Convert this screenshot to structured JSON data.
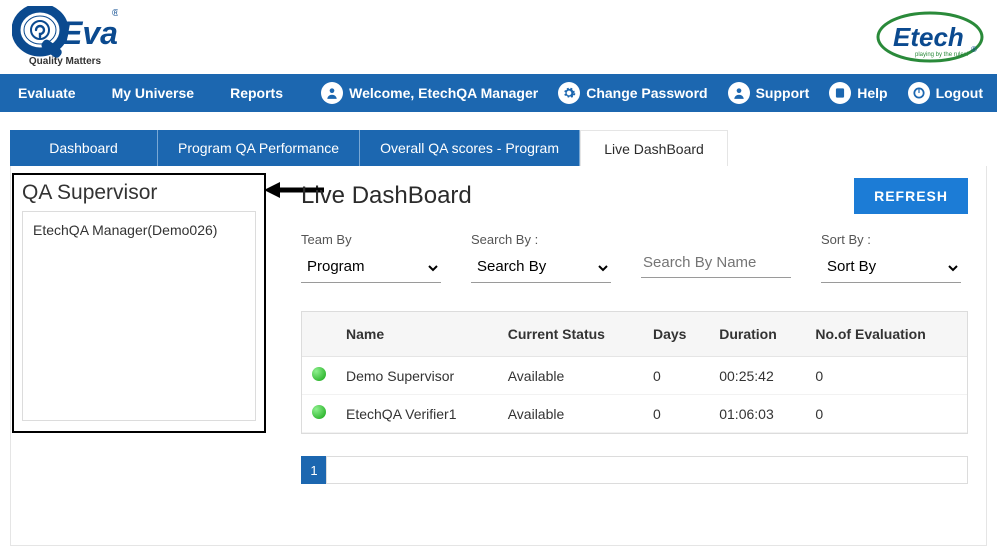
{
  "logos": {
    "left_brand": "QEval",
    "left_caption": "Quality Matters",
    "right_brand": "Etech",
    "right_tagline": "playing by the rules!"
  },
  "nav": {
    "items": [
      "Evaluate",
      "My Universe",
      "Reports"
    ],
    "welcome": "Welcome, EtechQA Manager",
    "change_password": "Change Password",
    "support": "Support",
    "help": "Help",
    "logout": "Logout"
  },
  "tabs": [
    "Dashboard",
    "Program QA Performance",
    "Overall QA scores - Program",
    "Live DashBoard"
  ],
  "active_tab_index": 3,
  "sidebar": {
    "title": "QA Supervisor",
    "items": [
      "EtechQA Manager(Demo026)"
    ]
  },
  "main": {
    "title": "Live DashBoard",
    "refresh_label": "REFRESH",
    "filters": {
      "team_by_label": "Team By",
      "team_by_value": "Program",
      "search_by_label": "Search By :",
      "search_by_value": "Search By",
      "search_name_placeholder": "Search By Name",
      "sort_by_label": "Sort By :",
      "sort_by_value": "Sort By"
    },
    "table": {
      "headers": [
        "",
        "Name",
        "Current Status",
        "Days",
        "Duration",
        "No.of Evaluation"
      ],
      "rows": [
        {
          "status": "available",
          "name": "Demo Supervisor",
          "current_status": "Available",
          "days": "0",
          "duration": "00:25:42",
          "evals": "0"
        },
        {
          "status": "available",
          "name": "EtechQA Verifier1",
          "current_status": "Available",
          "days": "0",
          "duration": "01:06:03",
          "evals": "0"
        }
      ]
    },
    "pager": {
      "current": "1"
    }
  }
}
